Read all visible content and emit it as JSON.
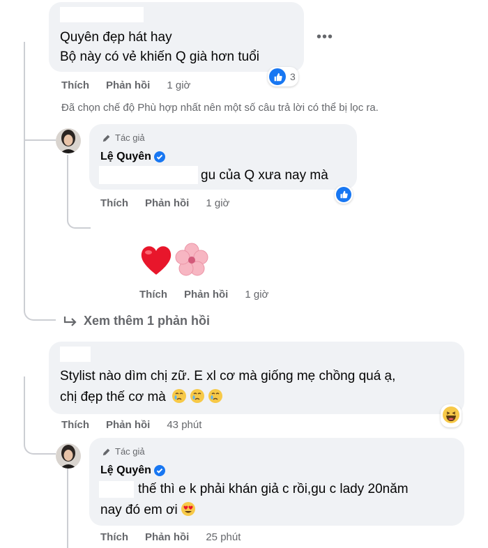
{
  "comments": [
    {
      "lines": [
        "Quyên đẹp hát hay",
        "Bộ này có vẻ khiến Q già hơn tuổi"
      ],
      "reaction_count": "3",
      "actions": {
        "like": "Thích",
        "reply": "Phản hồi",
        "time": "1 giờ"
      },
      "more_icon": "more-horizontal-icon"
    },
    {
      "author_tag": "Tác giả",
      "author_name": "Lệ Quyên",
      "text": "gu của Q xưa nay mà",
      "actions": {
        "like": "Thích",
        "reply": "Phản hồi",
        "time": "1 giờ"
      }
    },
    {
      "sticker": [
        "heart-emoji",
        "cherry-blossom-emoji"
      ],
      "actions": {
        "like": "Thích",
        "reply": "Phản hồi",
        "time": "1 giờ"
      }
    },
    {
      "lines": [
        "Stylist nào dìm chị zữ. E xl cơ mà giống mẹ chồng quá ạ,",
        "chị đẹp thế cơ mà"
      ],
      "actions": {
        "like": "Thích",
        "reply": "Phản hồi",
        "time": "43 phút"
      }
    },
    {
      "author_tag": "Tác giả",
      "author_name": "Lệ Quyên",
      "lines": [
        "thế thì e k phải khán giả c rồi,gu c lady 20năm",
        "nay đó em ơi"
      ],
      "actions": {
        "like": "Thích",
        "reply": "Phản hồi",
        "time": "25 phút"
      }
    }
  ],
  "filter_note": "Đã chọn chế độ Phù hợp nhất nên một số câu trả lời có thể bị lọc ra.",
  "see_more": "Xem thêm 1 phản hồi",
  "colors": {
    "bubble": "#f0f2f5",
    "meta_text": "#65676b",
    "brand_blue": "#1877f2"
  }
}
